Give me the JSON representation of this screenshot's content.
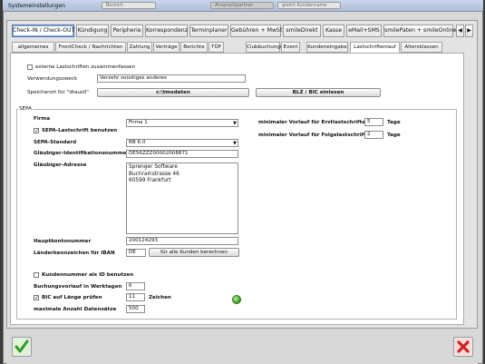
{
  "window": {
    "title": "Systemeinstellungen"
  },
  "top_bar": {
    "field1": "Bereich",
    "field2": "Ansprechpartner",
    "field3": "gleich Kundenname"
  },
  "main_tabs": [
    "Check-IN / Check-OUT",
    "Kündigung",
    "Peripherie",
    "Korrespondenz",
    "Terminplaner",
    "Gebühren + MwSt",
    "smileDirekt",
    "Kasse",
    "eMail+SMS",
    "smilePaten + smileOnline"
  ],
  "main_tabs_active": "Check-IN / Check-OUT",
  "sub_tabs": [
    "allgemeines",
    "FrontCheck / Nachrichten",
    "Zahlung",
    "Verträge",
    "Berichte",
    "TÜP",
    "Clubbuchungen",
    "Event",
    "Kundeneingabe",
    "Lastschriftenlauf",
    "Altersklassen"
  ],
  "sub_tabs_active": "Lastschriftenlauf",
  "top_section": {
    "extern_label": "externe Lastschriften zusammenfassen",
    "extern_checked": false,
    "verwendungszweck_label": "Verwendungszweck",
    "verwendungszweck_value": "Verzehr sonstiges anderes",
    "speicherort_label": "Speicherort für \"dtaus0\"",
    "speicherort_value": "c:\\tmsdaten",
    "blz_button": "BLZ / BIC einlesen"
  },
  "sepa": {
    "group_label": "SEPA",
    "firma_label": "Firma",
    "firma_value": "Firma 1",
    "sepa_use_label": "SEPA-Lastschrift benutzen",
    "sepa_use_checked": true,
    "standard_label": "SEPA-Standard",
    "standard_value": "RB 6.0",
    "glaeubiger_id_label": "Gläubiger-Identifikationsnummer",
    "glaeubiger_id_value": "DE56ZZZ00002008871",
    "glaeubiger_adresse_label": "Gläubiger-Adresse",
    "address_lines": [
      "Sprenger Software",
      "Buchrainstrasse 46",
      "60599 Frankfurt"
    ],
    "hauptkonto_label": "Hauptkontonummer",
    "hauptkonto_value": "200124293",
    "laenderkennzeichen_label": "Länderkennzeichen für IBAN",
    "laenderkennzeichen_value": "DE",
    "fuer_alle_button": "für alle Kunden berechnen",
    "erst_label": "minimaler Vorlauf für Erstlastschriften",
    "erst_value": "5",
    "folge_label": "minimaler Vorlauf für Folgelastschriften",
    "folge_value": "2",
    "tage": "Tage",
    "kundennummer_label": "Kundennummer als ID benutzen",
    "kundennummer_checked": false,
    "buchungsvorlauf_label": "Buchungsvorlauf in Werktagen",
    "buchungsvorlauf_value": "6",
    "bic_label": "BIC auf Länge prüfen",
    "bic_checked": true,
    "bic_value": "11",
    "zeichen": "Zeichen",
    "max_label": "maximale Anzahl Datensätze",
    "max_value": "500"
  },
  "icons": {
    "ok": "check-icon",
    "cancel": "x-icon",
    "info": "green-dot-icon"
  },
  "colors": {
    "ok_green": "#2f9a2a",
    "cancel_red": "#d42020",
    "active_tab_border": "#4d77b8"
  }
}
